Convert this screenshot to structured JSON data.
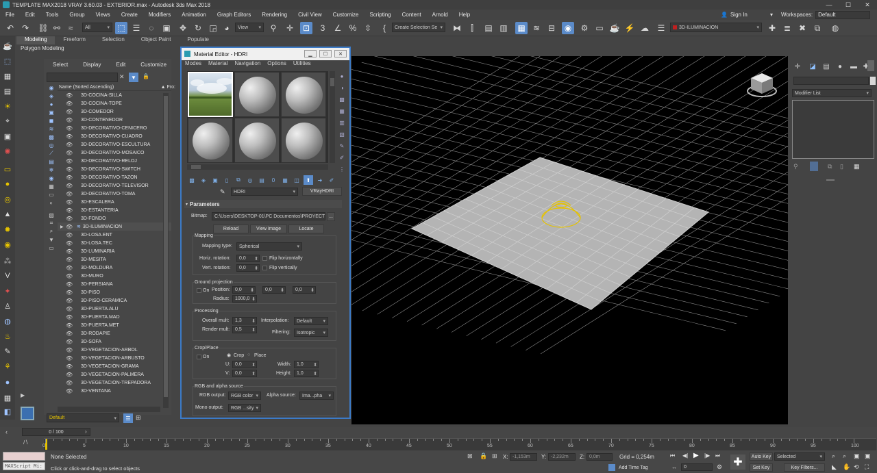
{
  "window": {
    "title": "TEMPLATE MAX2018 VRAY 3.60.03 - EXTERIOR.max - Autodesk 3ds Max 2018"
  },
  "menu": [
    "File",
    "Edit",
    "Tools",
    "Group",
    "Views",
    "Create",
    "Modifiers",
    "Animation",
    "Graph Editors",
    "Rendering",
    "Civil View",
    "Customize",
    "Scripting",
    "Content",
    "Arnold",
    "Help"
  ],
  "account": {
    "signin": "Sign In",
    "workspaces_label": "Workspaces:",
    "workspace": "Default"
  },
  "toolbar": {
    "filter": "All",
    "view": "View",
    "selection_set": "Create Selection Se",
    "layer": "3D-ILUMINACION"
  },
  "ribbon": {
    "tabs": [
      "Modeling",
      "Freeform",
      "Selection",
      "Object Paint",
      "Populate"
    ],
    "subtitle": "Polygon Modeling"
  },
  "explorer": {
    "menu": [
      "Select",
      "Display",
      "Edit",
      "Customize"
    ],
    "column": "Name (Sorted Ascending)",
    "column2": "Fro:",
    "items": [
      "3D-COCINA-SILLA",
      "3D-COCINA-TOPE",
      "3D-COMEDOR",
      "3D-CONTENEDOR",
      "3D-DECORATIVO-CENICERO",
      "3D-DECORATIVO-CUADRO",
      "3D-DECORATIVO-ESCULTURA",
      "3D-DECORATIVO-MOSAICO",
      "3D-DECORATIVO-RELOJ",
      "3D-DECORATIVO-SWITCH",
      "3D-DECORATIVO-TAZON",
      "3D-DECORATIVO-TELEVISOR",
      "3D-DECORATIVO-TOMA",
      "3D-ESCALERA",
      "3D-ESTANTERIA",
      "3D-FONDO",
      "3D-ILUMINACION",
      "3D-LOSA.ENT",
      "3D-LOSA.TEC",
      "3D-LUMINARIA",
      "3D-MESITA",
      "3D-MOLDURA",
      "3D-MURO",
      "3D-PERSIANA",
      "3D-PISO",
      "3D-PISO-CERAMICA",
      "3D-PUERTA.ALU",
      "3D-PUERTA.MAD",
      "3D-PUERTA.MET",
      "3D-RODAPIE",
      "3D-SOFA",
      "3D-VEGETACION-ARBOL",
      "3D-VEGETACION-ARBUSTO",
      "3D-VEGETACION-GRAMA",
      "3D-VEGETACION-PALMERA",
      "3D-VEGETACION-TREPADORA",
      "3D-VENTANA"
    ],
    "layer_dropdown": "Default"
  },
  "material_editor": {
    "title": "Material Editor - HDRI",
    "menu": [
      "Modes",
      "Material",
      "Navigation",
      "Options",
      "Utilities"
    ],
    "map_name": "HDRI",
    "map_type": "VRayHDRI",
    "rollout": "Parameters",
    "bitmap_label": "Bitmap:",
    "bitmap_path": "C:\\Users\\DESKTOP-01\\PC Documentos\\PROYECTO",
    "browse": "...",
    "buttons": {
      "reload": "Reload",
      "view_image": "View image",
      "locate": "Locate"
    },
    "mapping": {
      "title": "Mapping",
      "type_label": "Mapping type:",
      "type": "Spherical",
      "horiz_label": "Horiz. rotation:",
      "horiz": "0,0",
      "vert_label": "Vert. rotation:",
      "vert": "0,0",
      "flip_h": "Flip horizontally",
      "flip_v": "Flip vertically"
    },
    "ground": {
      "title": "Ground projection",
      "on": "On",
      "position_label": "Position:",
      "px": "0,0",
      "py": "0,0",
      "pz": "0,0",
      "radius_label": "Radius:",
      "radius": "1000,0"
    },
    "processing": {
      "title": "Processing",
      "overall_label": "Overall mult:",
      "overall": "1,3",
      "render_label": "Render mult:",
      "render": "0,5",
      "interp_label": "Interpolation:",
      "interp": "Default",
      "filter_label": "Filtering:",
      "filter": "Isotropic"
    },
    "crop": {
      "title": "Crop/Place",
      "on": "On",
      "crop": "Crop",
      "place": "Place",
      "u_label": "U:",
      "u": "0,0",
      "v_label": "V:",
      "v": "0,0",
      "w_label": "Width:",
      "w": "1,0",
      "h_label": "Height:",
      "h": "1,0"
    },
    "rgb": {
      "title": "RGB and alpha source",
      "rgb_label": "RGB output:",
      "rgb": "RGB color",
      "alpha_label": "Alpha source:",
      "alpha": "Ima...pha",
      "mono_label": "Mono output:",
      "mono": "RGB ...sity"
    }
  },
  "right_panel": {
    "modifier_list": "Modifier List"
  },
  "timeline": {
    "frame": "0 / 100",
    "ticks": [
      "0",
      "5",
      "10",
      "15",
      "20",
      "25",
      "30",
      "35",
      "40",
      "45",
      "50",
      "55",
      "60",
      "65",
      "70",
      "75",
      "80",
      "85",
      "90",
      "95",
      "100"
    ]
  },
  "status": {
    "maxscript": "MAXScript Mi:",
    "selection": "None Selected",
    "prompt": "Click or click-and-drag to select objects",
    "x_label": "X:",
    "x": "-1,153m",
    "y_label": "Y:",
    "y": "-2,232m",
    "z_label": "Z:",
    "z": "0,0m",
    "grid": "Grid = 0,254m",
    "add_time_tag": "Add Time Tag",
    "auto_key": "Auto Key",
    "set_key": "Set Key",
    "selected": "Selected",
    "key_filters": "Key Filters...",
    "frame_field": "0"
  },
  "colors": {
    "accent": "#5b8bc9",
    "editor_border": "#3c7bc8",
    "gizmo": "#e6c300"
  }
}
